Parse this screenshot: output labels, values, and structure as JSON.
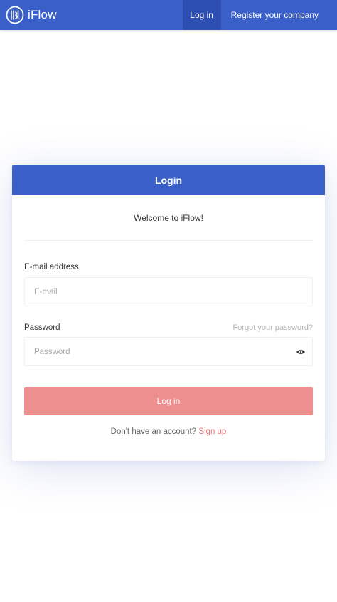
{
  "navbar": {
    "brand_name": "iFlow",
    "brand_icon": "iflow-logo-icon",
    "login_label": "Log in",
    "register_label": "Register your company",
    "color": "#3a5fc8",
    "active_color": "#2d4fb3"
  },
  "card": {
    "title": "Login",
    "welcome": "Welcome to iFlow!",
    "email": {
      "label": "E-mail address",
      "placeholder": "E-mail",
      "value": ""
    },
    "password": {
      "label": "Password",
      "placeholder": "Password",
      "value": "",
      "forgot_label": "Forgot your password?",
      "toggle_icon": "eye-icon"
    },
    "login_button": {
      "label": "Log in",
      "color": "#ee8f8f"
    },
    "signup": {
      "prompt": "Don't have an account?",
      "link_label": "Sign up"
    }
  }
}
